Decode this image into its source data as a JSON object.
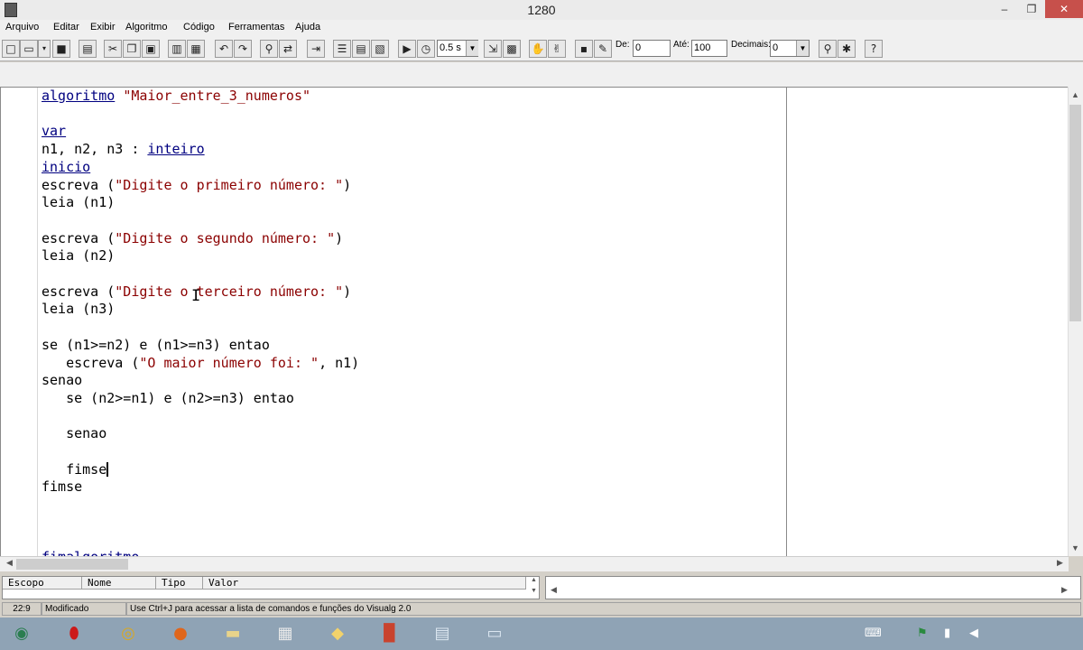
{
  "window": {
    "title": "1280",
    "minimize": "–",
    "restore": "❐",
    "close": "✕"
  },
  "menu": [
    "Arquivo",
    "Editar",
    "Exibir",
    "Algoritmo",
    "Código",
    "Ferramentas",
    "Ajuda"
  ],
  "toolbar": {
    "speed_value": "0.5 s",
    "de_label": "De:",
    "de_value": "0",
    "ate_label": "Até:",
    "ate_value": "100",
    "decimais_label": "Decimais:",
    "decimais_value": "0"
  },
  "editor": {
    "lines": [
      [
        {
          "t": "algoritmo",
          "c": "kw"
        },
        {
          "t": " "
        },
        {
          "t": "\"Maior_entre_3_numeros\"",
          "c": "str"
        }
      ],
      [],
      [
        {
          "t": "var",
          "c": "kw"
        }
      ],
      [
        {
          "t": "n1, n2, n3 : "
        },
        {
          "t": "inteiro",
          "c": "kw"
        }
      ],
      [
        {
          "t": "inicio",
          "c": "kw"
        }
      ],
      [
        {
          "t": "escreva ("
        },
        {
          "t": "\"Digite o primeiro número: \"",
          "c": "str"
        },
        {
          "t": ")"
        }
      ],
      [
        {
          "t": "leia (n1)"
        }
      ],
      [],
      [
        {
          "t": "escreva ("
        },
        {
          "t": "\"Digite o segundo número: \"",
          "c": "str"
        },
        {
          "t": ")"
        }
      ],
      [
        {
          "t": "leia (n2)"
        }
      ],
      [],
      [
        {
          "t": "escreva ("
        },
        {
          "t": "\"Digite o terceiro número: \"",
          "c": "str"
        },
        {
          "t": ")"
        }
      ],
      [
        {
          "t": "leia (n3)"
        }
      ],
      [],
      [
        {
          "t": "se (n1>=n2) e (n1>=n3) entao"
        }
      ],
      [
        {
          "t": "   escreva ("
        },
        {
          "t": "\"O maior número foi: \"",
          "c": "str"
        },
        {
          "t": ", n1)"
        }
      ],
      [
        {
          "t": "senao"
        }
      ],
      [
        {
          "t": "   se (n2>=n1) e (n2>=n3) entao"
        }
      ],
      [],
      [
        {
          "t": "   senao"
        }
      ],
      [],
      [
        {
          "t": "   fimse",
          "cursor": true
        }
      ],
      [
        {
          "t": "fimse"
        }
      ]
    ]
  },
  "variables": {
    "columns": [
      "Escopo",
      "Nome",
      "Tipo",
      "Valor"
    ]
  },
  "status": {
    "position": "22:9",
    "state": "Modificado",
    "hint": "Use Ctrl+J para acessar a lista de comandos e funções do Visualg 2.0"
  },
  "taskbar": {
    "apps": [
      "globe-app-icon",
      "opera-icon",
      "chrome-icon",
      "firefox-icon",
      "file-explorer-icon",
      "calculator-icon",
      "folder-icon",
      "powerpoint-icon",
      "visualg-icon",
      "window-app-icon"
    ],
    "tray": [
      "keyboard-icon",
      "flag-icon",
      "network-icon",
      "volume-icon"
    ]
  }
}
